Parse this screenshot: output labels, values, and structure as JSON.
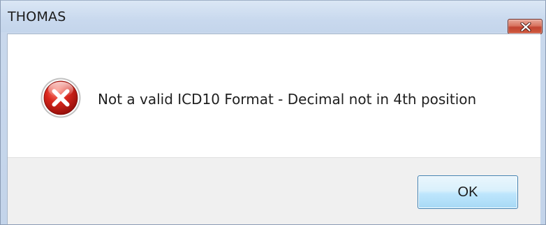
{
  "dialog": {
    "title": "THOMAS",
    "message": "Not a valid ICD10 Format - Decimal not in 4th position",
    "ok_label": "OK",
    "icon": "error-icon"
  },
  "colors": {
    "titlebar": "#c9d9ee",
    "close_button": "#c94a35",
    "error_icon": "#c8221c",
    "button_area": "#f0f0f0",
    "ok_border": "#3c7fb1"
  }
}
